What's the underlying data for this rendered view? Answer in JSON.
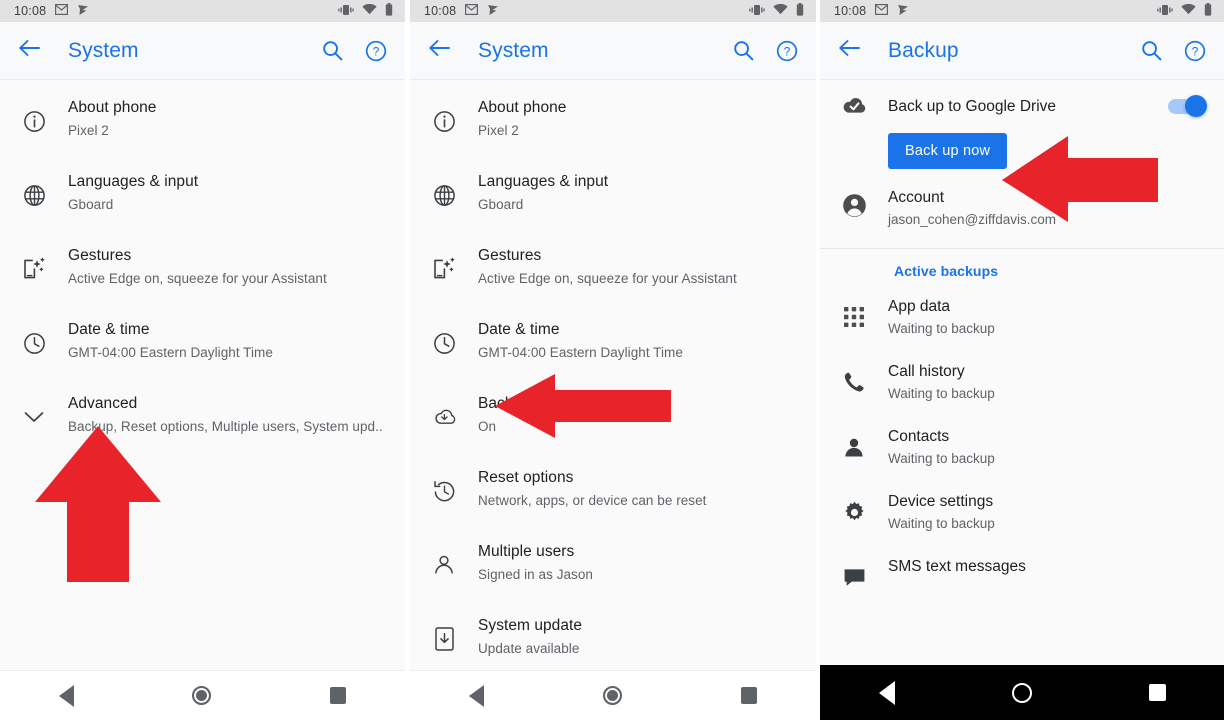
{
  "statusbar": {
    "time": "10:08",
    "icons": [
      "gmail-icon",
      "notification-flag-icon",
      "vibrate-icon",
      "wifi-icon",
      "battery-icon"
    ]
  },
  "colors": {
    "accent_blue": "#1a73e8",
    "annotation_red": "#e8232a",
    "status_bar_bg": "#e2e2e2",
    "app_bar_bg": "#f8f9fa",
    "list_bg": "#fafafa",
    "primary_text": "#202124",
    "secondary_text": "#5f6368"
  },
  "panel1": {
    "appbar": {
      "title": "System",
      "back": "back-arrow-icon",
      "search": "search-icon",
      "help": "help-icon"
    },
    "items": [
      {
        "icon": "info-circle-icon",
        "title": "About phone",
        "subtitle": "Pixel 2"
      },
      {
        "icon": "globe-icon",
        "title": "Languages & input",
        "subtitle": "Gboard"
      },
      {
        "icon": "gestures-icon",
        "title": "Gestures",
        "subtitle": "Active Edge on, squeeze for your Assistant"
      },
      {
        "icon": "clock-icon",
        "title": "Date & time",
        "subtitle": "GMT-04:00 Eastern Daylight Time"
      },
      {
        "icon": "chevron-down-icon",
        "title": "Advanced",
        "subtitle": "Backup, Reset options, Multiple users, System upd.."
      }
    ],
    "annotation": {
      "shape": "arrow-up",
      "points_to": "Advanced"
    }
  },
  "panel2": {
    "appbar": {
      "title": "System",
      "back": "back-arrow-icon",
      "search": "search-icon",
      "help": "help-icon"
    },
    "items": [
      {
        "icon": "info-circle-icon",
        "title": "About phone",
        "subtitle": "Pixel 2"
      },
      {
        "icon": "globe-icon",
        "title": "Languages & input",
        "subtitle": "Gboard"
      },
      {
        "icon": "gestures-icon",
        "title": "Gestures",
        "subtitle": "Active Edge on, squeeze for your Assistant"
      },
      {
        "icon": "clock-icon",
        "title": "Date & time",
        "subtitle": "GMT-04:00 Eastern Daylight Time"
      },
      {
        "icon": "cloud-upload-icon",
        "title": "Backup",
        "subtitle": "On"
      },
      {
        "icon": "history-icon",
        "title": "Reset options",
        "subtitle": "Network, apps, or device can be reset"
      },
      {
        "icon": "person-icon",
        "title": "Multiple users",
        "subtitle": "Signed in as Jason"
      },
      {
        "icon": "system-update-icon",
        "title": "System update",
        "subtitle": "Update available"
      }
    ],
    "annotation": {
      "shape": "arrow-left",
      "points_to": "Backup"
    }
  },
  "panel3": {
    "appbar": {
      "title": "Backup",
      "back": "back-arrow-icon",
      "search": "search-icon",
      "help": "help-icon"
    },
    "drive": {
      "icon": "cloud-check-icon",
      "label": "Back up to Google Drive",
      "toggle_state": "on",
      "button_label": "Back up now"
    },
    "account": {
      "icon": "account-circle-icon",
      "title": "Account",
      "subtitle": "jason_cohen@ziffdavis.com"
    },
    "section_title": "Active backups",
    "backups": [
      {
        "icon": "apps-grid-icon",
        "title": "App data",
        "subtitle": "Waiting to backup"
      },
      {
        "icon": "phone-icon",
        "title": "Call history",
        "subtitle": "Waiting to backup"
      },
      {
        "icon": "contacts-icon",
        "title": "Contacts",
        "subtitle": "Waiting to backup"
      },
      {
        "icon": "gear-icon",
        "title": "Device settings",
        "subtitle": "Waiting to backup"
      },
      {
        "icon": "sms-icon",
        "title": "SMS text messages",
        "subtitle": ""
      }
    ],
    "annotation": {
      "shape": "arrow-left",
      "points_to": "Back up now"
    }
  },
  "navbar": {
    "back": "nav-back-triangle-icon",
    "home": "nav-home-circle-icon",
    "recents": "nav-recents-square-icon"
  }
}
